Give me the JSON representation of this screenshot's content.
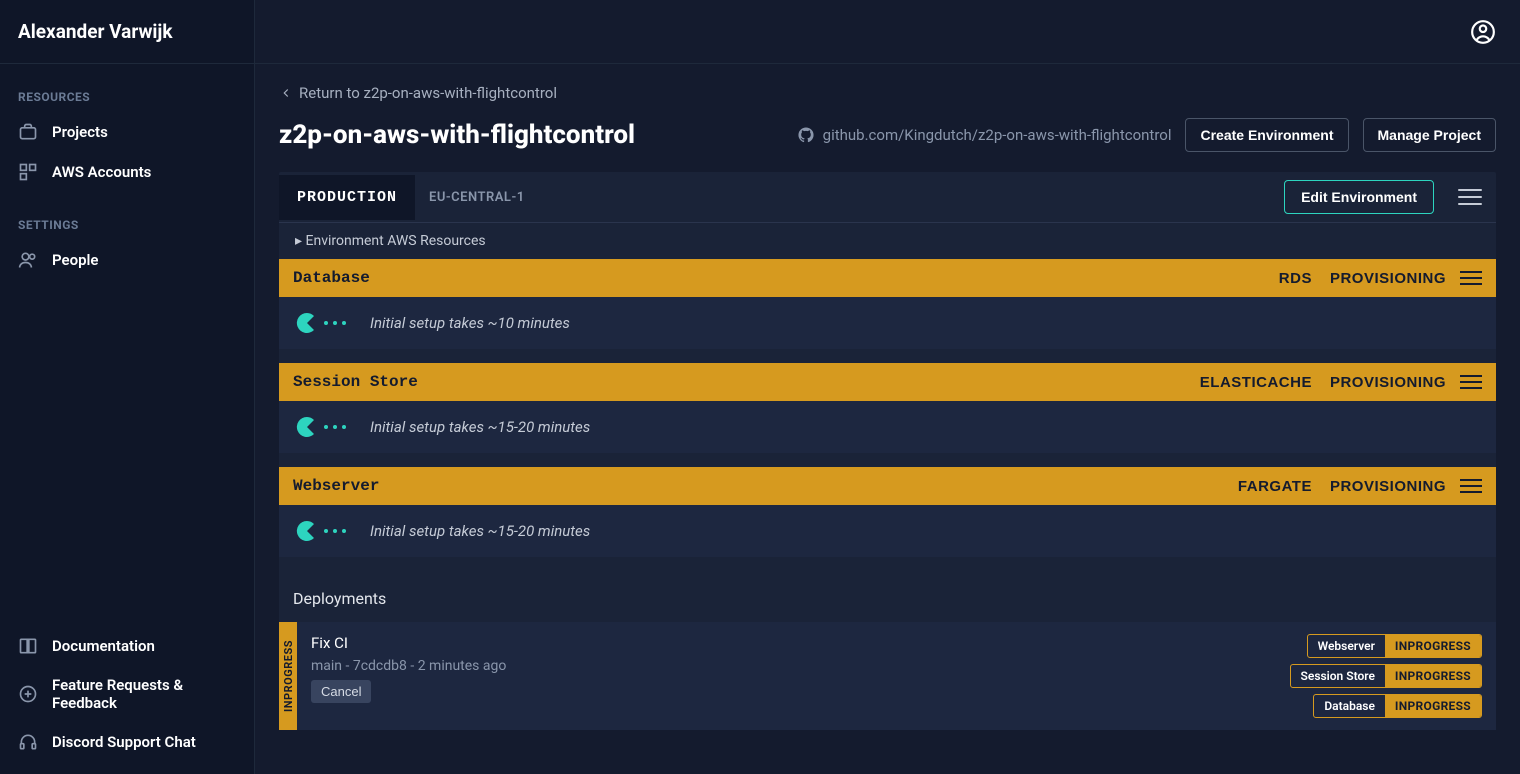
{
  "sidebar": {
    "owner": "Alexander Varwijk",
    "sections": {
      "resources_label": "RESOURCES",
      "settings_label": "SETTINGS"
    },
    "items": {
      "projects": "Projects",
      "aws_accounts": "AWS Accounts",
      "people": "People",
      "documentation": "Documentation",
      "feedback": "Feature Requests & Feedback",
      "discord": "Discord Support Chat"
    }
  },
  "header": {
    "return_label": "Return to z2p-on-aws-with-flightcontrol",
    "title": "z2p-on-aws-with-flightcontrol",
    "repo": "github.com/Kingdutch/z2p-on-aws-with-flightcontrol",
    "create_env": "Create Environment",
    "manage_project": "Manage Project"
  },
  "env": {
    "tab": "PRODUCTION",
    "region": "EU-CENTRAL-1",
    "edit": "Edit Environment",
    "resources_expand": "Environment AWS Resources"
  },
  "services": [
    {
      "name": "Database",
      "type": "RDS",
      "status": "PROVISIONING",
      "message": "Initial setup takes ~10 minutes"
    },
    {
      "name": "Session Store",
      "type": "ELASTICACHE",
      "status": "PROVISIONING",
      "message": "Initial setup takes ~15-20 minutes"
    },
    {
      "name": "Webserver",
      "type": "FARGATE",
      "status": "PROVISIONING",
      "message": "Initial setup takes ~15-20 minutes"
    }
  ],
  "deployments": {
    "heading": "Deployments",
    "stripe": "INPROGRESS",
    "title": "Fix CI",
    "meta": "main - 7cdcdb8 - 2 minutes ago",
    "cancel": "Cancel",
    "badges": [
      {
        "name": "Webserver",
        "status": "INPROGRESS"
      },
      {
        "name": "Session Store",
        "status": "INPROGRESS"
      },
      {
        "name": "Database",
        "status": "INPROGRESS"
      }
    ]
  }
}
